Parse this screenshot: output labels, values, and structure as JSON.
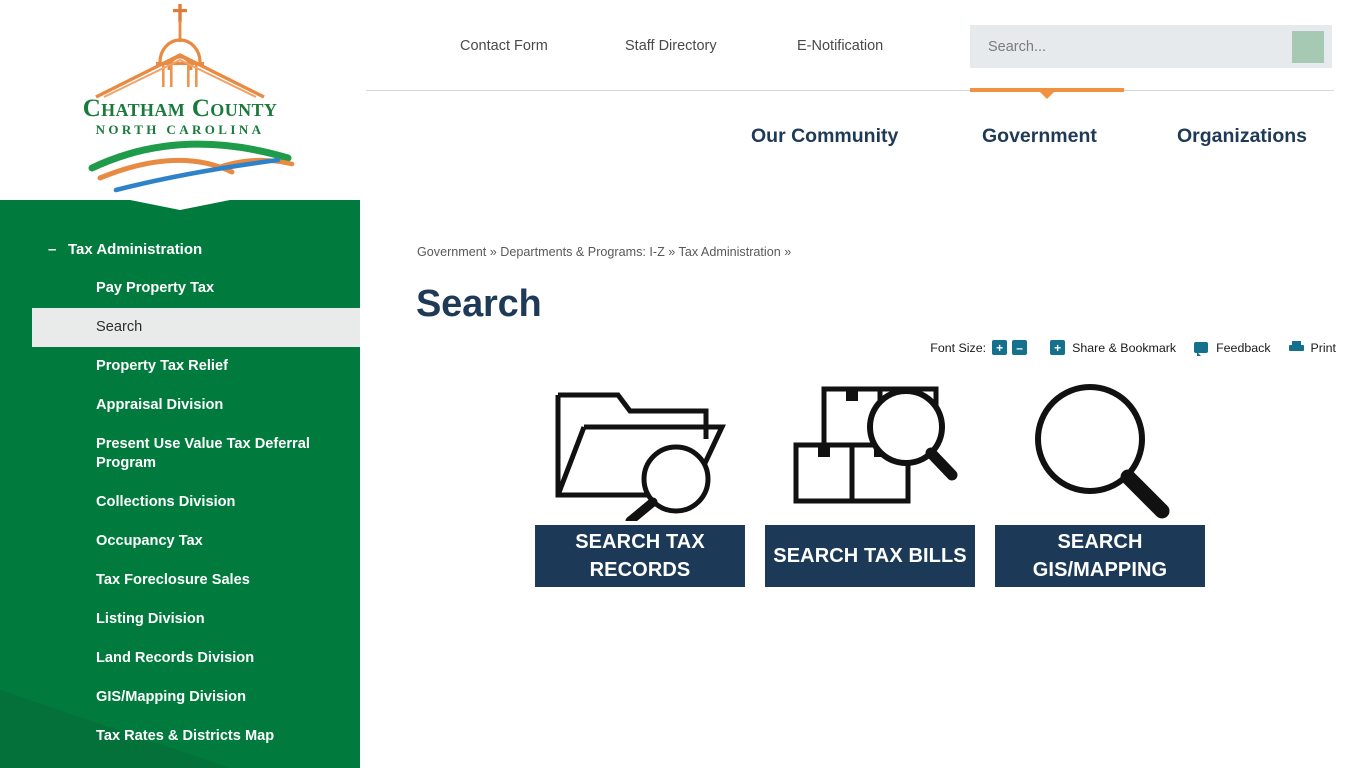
{
  "site": {
    "logo_line1": "Chatham County",
    "logo_line2": "NORTH CAROLINA",
    "logo_icon": "courthouse-cupola-logo"
  },
  "topbar": {
    "links": [
      {
        "label": "Contact Form"
      },
      {
        "label": "Staff Directory"
      },
      {
        "label": "E-Notification"
      }
    ],
    "search": {
      "placeholder": "Search...",
      "value": "",
      "submit_icon": "search-submit-button"
    }
  },
  "mainnav": {
    "items": [
      {
        "label": "Our Community",
        "active": false
      },
      {
        "label": "Government",
        "active": true
      },
      {
        "label": "Organizations",
        "active": false
      }
    ],
    "accent_color": "#f2913f"
  },
  "sidebar": {
    "background_color": "#007a3d",
    "items": [
      {
        "label": "Tax Administration",
        "toggle": "–",
        "level": "top",
        "active": false
      },
      {
        "label": "Pay Property Tax",
        "level": "child",
        "active": false
      },
      {
        "label": "Search",
        "level": "child",
        "active": true
      },
      {
        "label": "Property Tax Relief",
        "level": "child",
        "active": false
      },
      {
        "label": "Appraisal Division",
        "level": "child",
        "active": false
      },
      {
        "label": "Present Use Value Tax Deferral Program",
        "level": "child",
        "active": false
      },
      {
        "label": "Collections Division",
        "level": "child",
        "active": false
      },
      {
        "label": "Occupancy Tax",
        "level": "child",
        "active": false
      },
      {
        "label": "Tax Foreclosure Sales",
        "level": "child",
        "active": false
      },
      {
        "label": "Listing Division",
        "level": "child",
        "active": false
      },
      {
        "label": "Land Records Division",
        "level": "child",
        "active": false
      },
      {
        "label": "GIS/Mapping Division",
        "level": "child",
        "active": false
      },
      {
        "label": "Tax Rates & Districts Map",
        "level": "child",
        "active": false
      }
    ]
  },
  "content": {
    "breadcrumb": "Government » Departments & Programs: I-Z » Tax Administration »",
    "title": "Search",
    "toolbar": {
      "font_size_label": "Font Size:",
      "increase_label": "+",
      "decrease_label": "–",
      "share_plus_label": "+",
      "share_label": "Share & Bookmark",
      "feedback_label": "Feedback",
      "print_label": "Print",
      "icon_color": "#14708d"
    },
    "tiles": [
      {
        "label": "SEARCH TAX RECORDS",
        "icon": "folder-search-icon"
      },
      {
        "label": "SEARCH TAX BILLS",
        "icon": "boxes-search-icon"
      },
      {
        "label": "SEARCH GIS/MAPPING",
        "icon": "magnifier-icon"
      }
    ],
    "tile_color": "#1c3a58"
  }
}
